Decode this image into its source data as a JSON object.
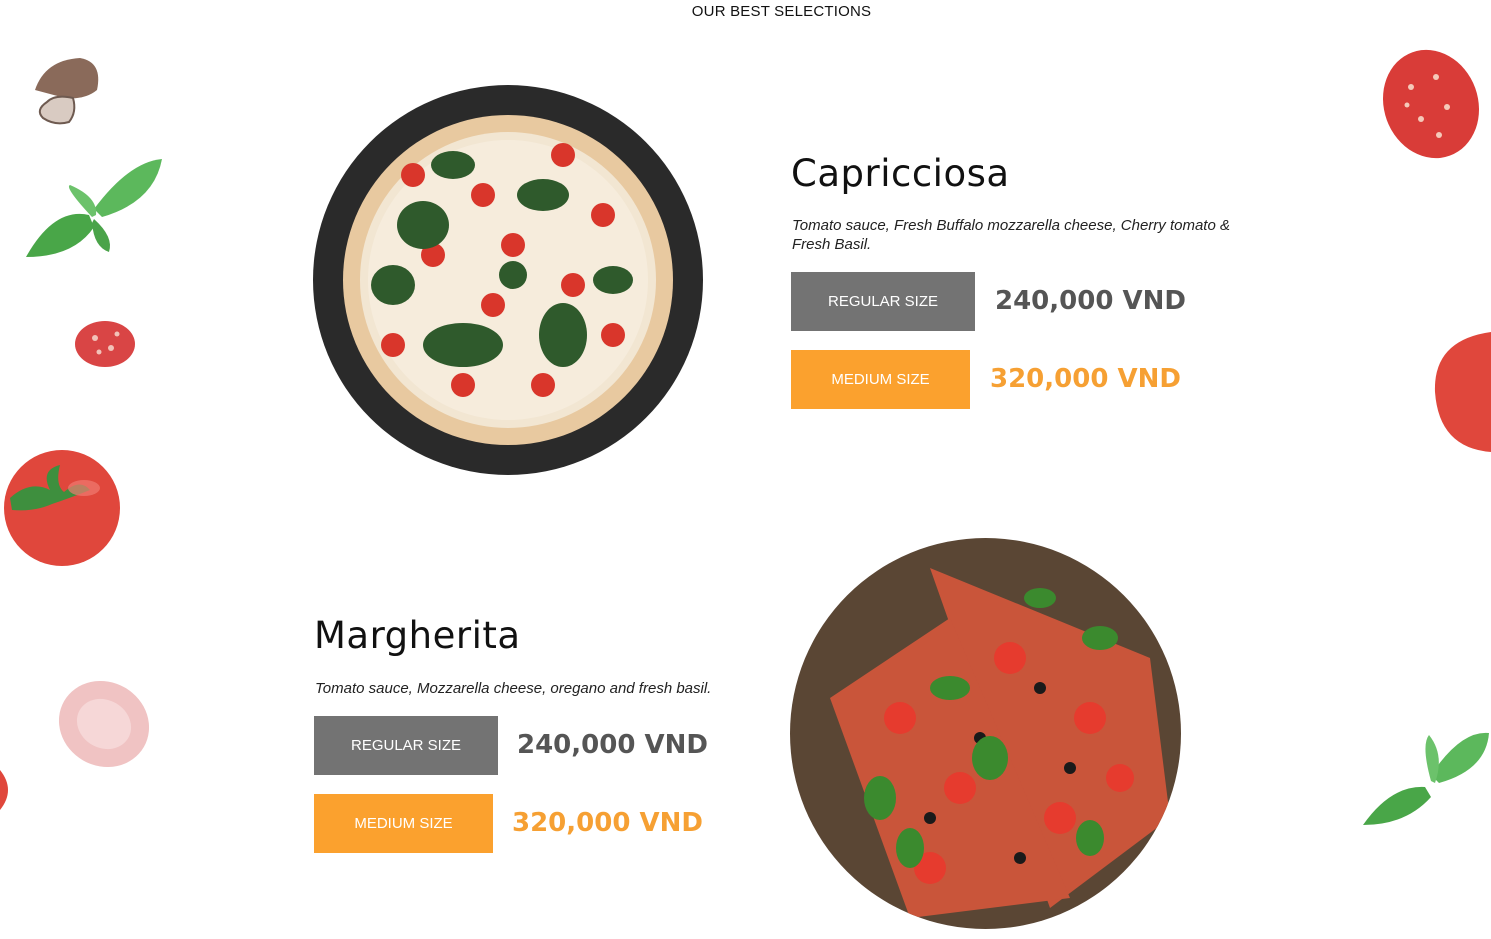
{
  "section": {
    "title": "OUR BEST SELECTIONS"
  },
  "pizzas": [
    {
      "name": "Capricciosa",
      "description": "Tomato sauce, Fresh Buffalo mozzarella cheese, Cherry tomato & Fresh Basil.",
      "regular_label": "REGULAR SIZE",
      "regular_price": "240,000 VND",
      "medium_label": "MEDIUM SIZE",
      "medium_price": "320,000 VND"
    },
    {
      "name": "Margherita",
      "description": "Tomato sauce, Mozzarella cheese, oregano and fresh basil.",
      "regular_label": "REGULAR SIZE",
      "regular_price": "240,000 VND",
      "medium_label": "MEDIUM SIZE",
      "medium_price": "320,000 VND"
    }
  ],
  "colors": {
    "regular_button": "#737373",
    "medium_button": "#fba12e",
    "medium_price": "#f6a033",
    "regular_price": "#555555"
  },
  "icons": [
    "mushroom-icon",
    "basil-leaf-icon",
    "salami-slice-icon",
    "tomato-icon",
    "ham-slice-icon"
  ]
}
